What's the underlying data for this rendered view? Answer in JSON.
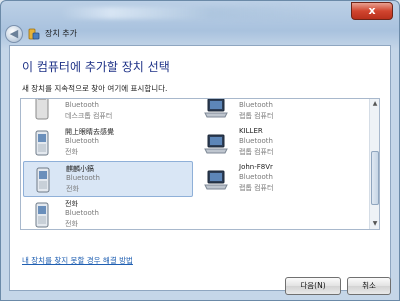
{
  "window": {
    "close_label": "x",
    "nav_title": "장치 추가"
  },
  "heading": "이 컴퓨터에 추가할 장치 선택",
  "subheading": "새 장치를 지속적으로 찾아 여기에 표시합니다.",
  "devices": [
    {
      "name": "",
      "type": "Bluetooth",
      "category": "데스크톱 컴퓨터",
      "icon": "desktop-icon"
    },
    {
      "name": "",
      "type": "Bluetooth",
      "category": "랩톱 컴퓨터",
      "icon": "laptop-icon"
    },
    {
      "name": "開上眼睛去感覺",
      "type": "Bluetooth",
      "category": "전화",
      "icon": "phone-icon"
    },
    {
      "name": "KILLER",
      "type": "Bluetooth",
      "category": "랩톱 컴퓨터",
      "icon": "laptop-icon"
    },
    {
      "name": "麒麟小鎬",
      "type": "Bluetooth",
      "category": "전화",
      "icon": "phone-icon",
      "selected": true
    },
    {
      "name": "John-F8Vr",
      "type": "Bluetooth",
      "category": "랩톱 컴퓨터",
      "icon": "laptop-icon"
    },
    {
      "name": "전화",
      "type": "Bluetooth",
      "category": "전화",
      "icon": "phone-icon"
    }
  ],
  "help_link": "내 장치를 찾지 못할 경우 해결 방법",
  "buttons": {
    "next": "다음(N)",
    "cancel": "취소"
  }
}
